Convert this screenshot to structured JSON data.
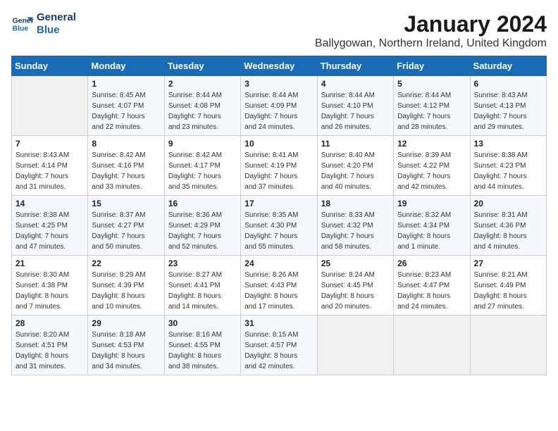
{
  "logo": {
    "line1": "General",
    "line2": "Blue"
  },
  "title": "January 2024",
  "location": "Ballygowan, Northern Ireland, United Kingdom",
  "days_of_week": [
    "Sunday",
    "Monday",
    "Tuesday",
    "Wednesday",
    "Thursday",
    "Friday",
    "Saturday"
  ],
  "weeks": [
    [
      {
        "day": "",
        "data": ""
      },
      {
        "day": "1",
        "data": "Sunrise: 8:45 AM\nSunset: 4:07 PM\nDaylight: 7 hours\nand 22 minutes."
      },
      {
        "day": "2",
        "data": "Sunrise: 8:44 AM\nSunset: 4:08 PM\nDaylight: 7 hours\nand 23 minutes."
      },
      {
        "day": "3",
        "data": "Sunrise: 8:44 AM\nSunset: 4:09 PM\nDaylight: 7 hours\nand 24 minutes."
      },
      {
        "day": "4",
        "data": "Sunrise: 8:44 AM\nSunset: 4:10 PM\nDaylight: 7 hours\nand 26 minutes."
      },
      {
        "day": "5",
        "data": "Sunrise: 8:44 AM\nSunset: 4:12 PM\nDaylight: 7 hours\nand 28 minutes."
      },
      {
        "day": "6",
        "data": "Sunrise: 8:43 AM\nSunset: 4:13 PM\nDaylight: 7 hours\nand 29 minutes."
      }
    ],
    [
      {
        "day": "7",
        "data": "Sunrise: 8:43 AM\nSunset: 4:14 PM\nDaylight: 7 hours\nand 31 minutes."
      },
      {
        "day": "8",
        "data": "Sunrise: 8:42 AM\nSunset: 4:16 PM\nDaylight: 7 hours\nand 33 minutes."
      },
      {
        "day": "9",
        "data": "Sunrise: 8:42 AM\nSunset: 4:17 PM\nDaylight: 7 hours\nand 35 minutes."
      },
      {
        "day": "10",
        "data": "Sunrise: 8:41 AM\nSunset: 4:19 PM\nDaylight: 7 hours\nand 37 minutes."
      },
      {
        "day": "11",
        "data": "Sunrise: 8:40 AM\nSunset: 4:20 PM\nDaylight: 7 hours\nand 40 minutes."
      },
      {
        "day": "12",
        "data": "Sunrise: 8:39 AM\nSunset: 4:22 PM\nDaylight: 7 hours\nand 42 minutes."
      },
      {
        "day": "13",
        "data": "Sunrise: 8:38 AM\nSunset: 4:23 PM\nDaylight: 7 hours\nand 44 minutes."
      }
    ],
    [
      {
        "day": "14",
        "data": "Sunrise: 8:38 AM\nSunset: 4:25 PM\nDaylight: 7 hours\nand 47 minutes."
      },
      {
        "day": "15",
        "data": "Sunrise: 8:37 AM\nSunset: 4:27 PM\nDaylight: 7 hours\nand 50 minutes."
      },
      {
        "day": "16",
        "data": "Sunrise: 8:36 AM\nSunset: 4:29 PM\nDaylight: 7 hours\nand 52 minutes."
      },
      {
        "day": "17",
        "data": "Sunrise: 8:35 AM\nSunset: 4:30 PM\nDaylight: 7 hours\nand 55 minutes."
      },
      {
        "day": "18",
        "data": "Sunrise: 8:33 AM\nSunset: 4:32 PM\nDaylight: 7 hours\nand 58 minutes."
      },
      {
        "day": "19",
        "data": "Sunrise: 8:32 AM\nSunset: 4:34 PM\nDaylight: 8 hours\nand 1 minute."
      },
      {
        "day": "20",
        "data": "Sunrise: 8:31 AM\nSunset: 4:36 PM\nDaylight: 8 hours\nand 4 minutes."
      }
    ],
    [
      {
        "day": "21",
        "data": "Sunrise: 8:30 AM\nSunset: 4:38 PM\nDaylight: 8 hours\nand 7 minutes."
      },
      {
        "day": "22",
        "data": "Sunrise: 8:29 AM\nSunset: 4:39 PM\nDaylight: 8 hours\nand 10 minutes."
      },
      {
        "day": "23",
        "data": "Sunrise: 8:27 AM\nSunset: 4:41 PM\nDaylight: 8 hours\nand 14 minutes."
      },
      {
        "day": "24",
        "data": "Sunrise: 8:26 AM\nSunset: 4:43 PM\nDaylight: 8 hours\nand 17 minutes."
      },
      {
        "day": "25",
        "data": "Sunrise: 8:24 AM\nSunset: 4:45 PM\nDaylight: 8 hours\nand 20 minutes."
      },
      {
        "day": "26",
        "data": "Sunrise: 8:23 AM\nSunset: 4:47 PM\nDaylight: 8 hours\nand 24 minutes."
      },
      {
        "day": "27",
        "data": "Sunrise: 8:21 AM\nSunset: 4:49 PM\nDaylight: 8 hours\nand 27 minutes."
      }
    ],
    [
      {
        "day": "28",
        "data": "Sunrise: 8:20 AM\nSunset: 4:51 PM\nDaylight: 8 hours\nand 31 minutes."
      },
      {
        "day": "29",
        "data": "Sunrise: 8:18 AM\nSunset: 4:53 PM\nDaylight: 8 hours\nand 34 minutes."
      },
      {
        "day": "30",
        "data": "Sunrise: 8:16 AM\nSunset: 4:55 PM\nDaylight: 8 hours\nand 38 minutes."
      },
      {
        "day": "31",
        "data": "Sunrise: 8:15 AM\nSunset: 4:57 PM\nDaylight: 8 hours\nand 42 minutes."
      },
      {
        "day": "",
        "data": ""
      },
      {
        "day": "",
        "data": ""
      },
      {
        "day": "",
        "data": ""
      }
    ]
  ]
}
